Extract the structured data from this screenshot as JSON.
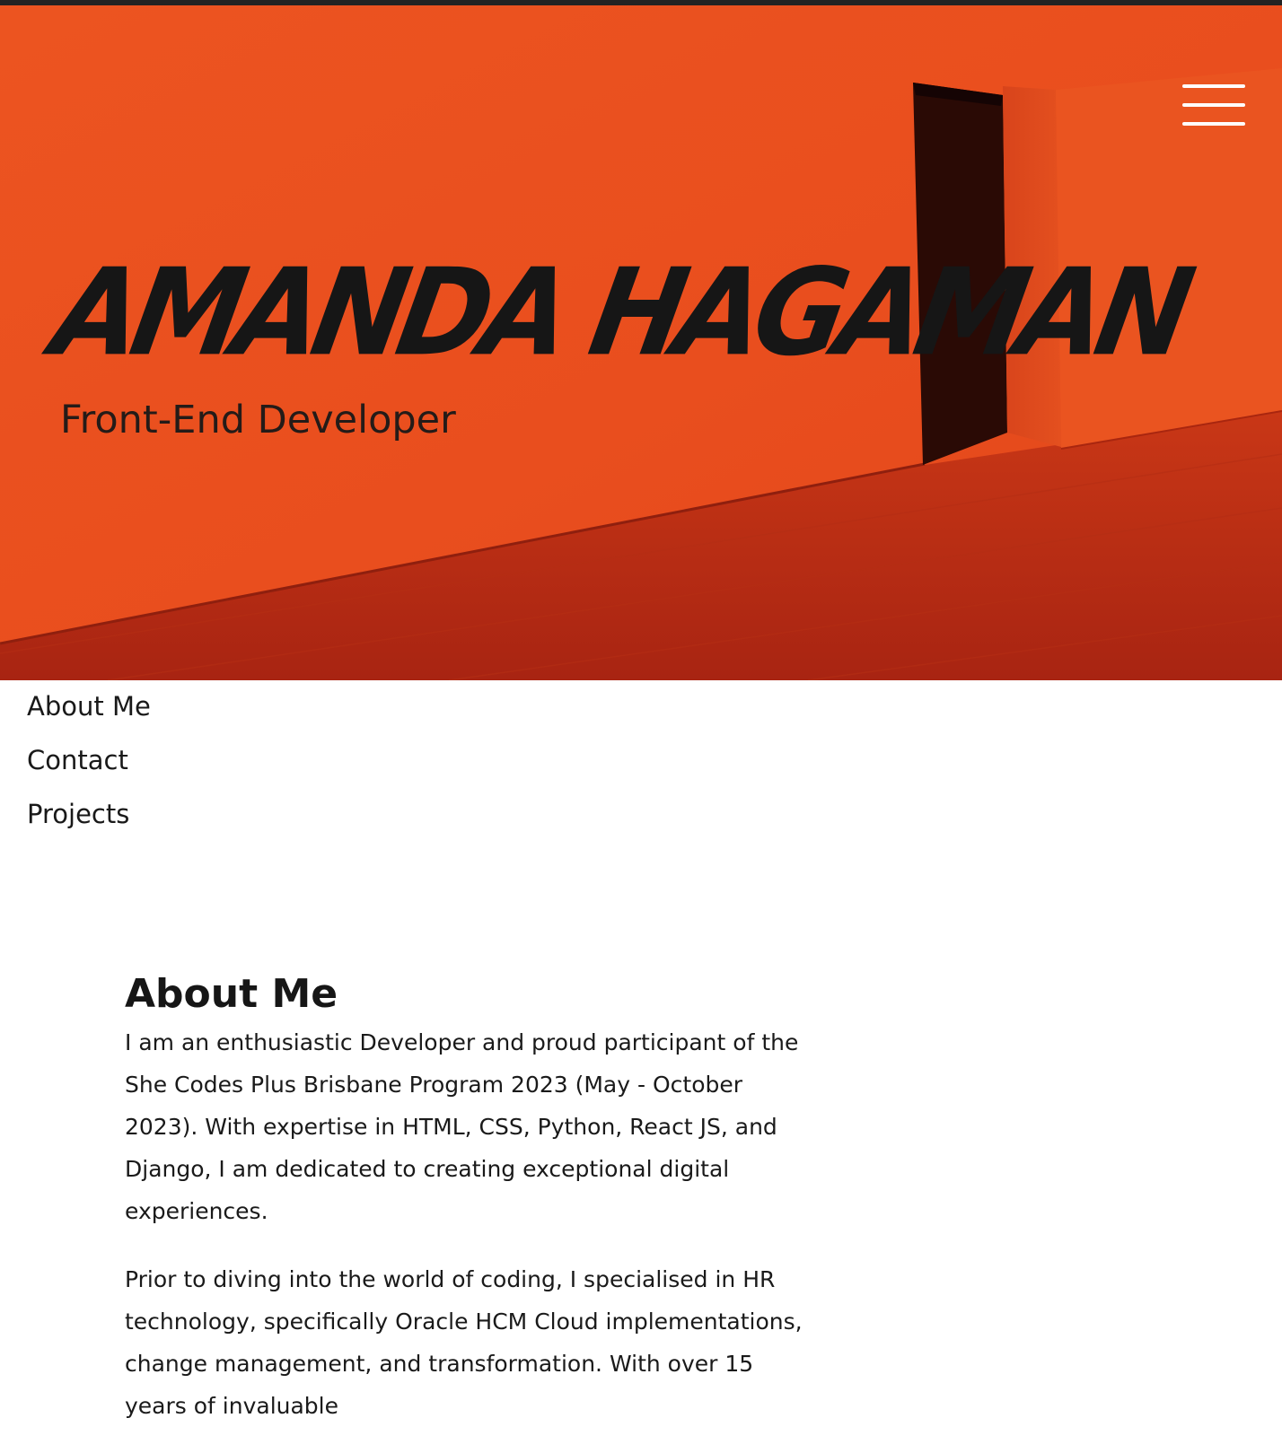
{
  "hero": {
    "name": "AMANDA HAGAMAN",
    "subtitle": "Front-End Developer",
    "background_color": "#E9531F",
    "menu_icon": "hamburger-menu-icon"
  },
  "nav": {
    "items": [
      {
        "label": "About Me"
      },
      {
        "label": "Contact"
      },
      {
        "label": "Projects"
      }
    ]
  },
  "about": {
    "heading": "About Me",
    "paragraphs": [
      "I am an enthusiastic Developer and proud participant of the She Codes Plus Brisbane Program 2023 (May - October 2023). With expertise in HTML, CSS, Python, React JS, and Django, I am dedicated to creating exceptional digital experiences.",
      "Prior to diving into the world of coding, I specialised in HR technology, specifically Oracle HCM Cloud implementations, change management, and transformation. With over 15 years of invaluable"
    ]
  }
}
